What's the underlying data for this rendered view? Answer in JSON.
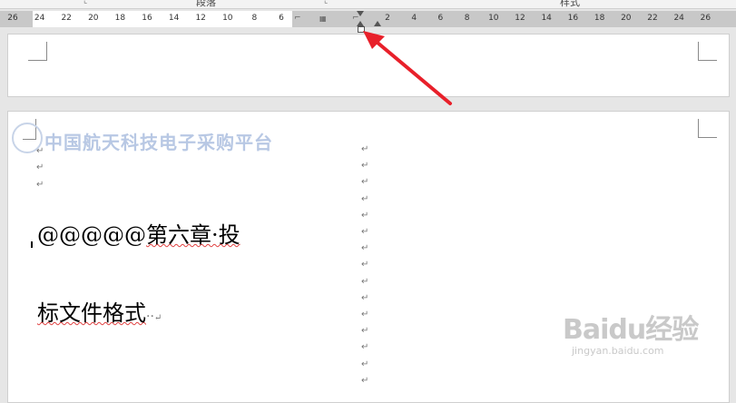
{
  "ribbon": {
    "group_paragraph": "段落",
    "group_styles": "样式"
  },
  "ruler": {
    "left_numbers": [
      "26",
      "24",
      "22",
      "20",
      "18",
      "16",
      "14",
      "12",
      "10",
      "8",
      "6"
    ],
    "right_numbers": [
      "2",
      "4",
      "6",
      "8",
      "10",
      "12",
      "14",
      "16",
      "18",
      "20",
      "22",
      "24",
      "26"
    ]
  },
  "watermark": {
    "text": "中国航天科技电子采购平台"
  },
  "document": {
    "heading_prefix": "@@@@@",
    "heading_line1": "第六章·投",
    "heading_line2": "标文件格式",
    "heading_line2_tail": "··",
    "paragraph_mark": "↵"
  },
  "baidu_watermark": {
    "main": "Baidu经验",
    "sub": "jingyan.baidu.com"
  },
  "colors": {
    "arrow": "#e8202a",
    "squiggle": "#e04040",
    "watermark": "#b8c8e4"
  }
}
